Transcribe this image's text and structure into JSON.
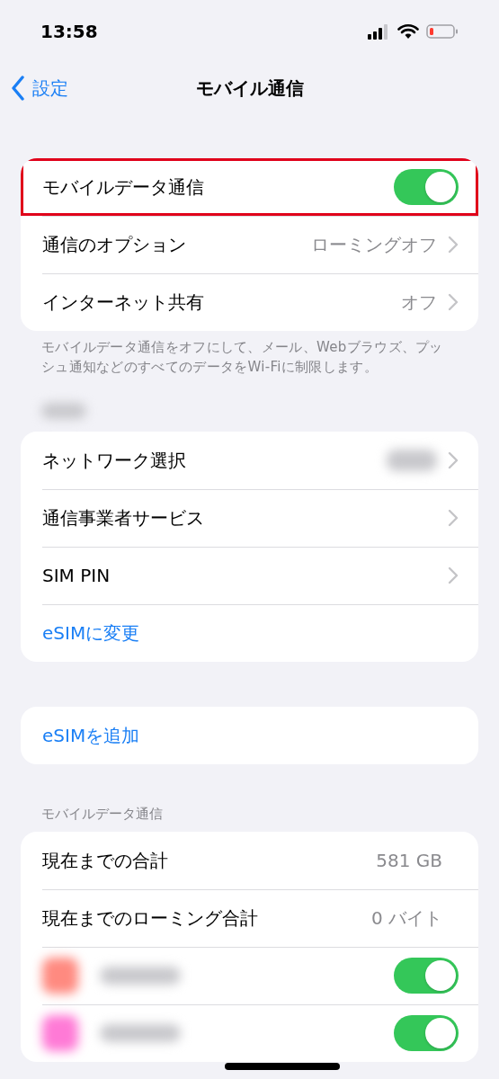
{
  "status_bar": {
    "time": "13:58"
  },
  "nav": {
    "back_label": "設定",
    "title": "モバイル通信"
  },
  "sections": [
    {
      "rows": [
        {
          "kind": "toggle",
          "label": "モバイルデータ通信",
          "on": true,
          "highlighted": true
        },
        {
          "kind": "detail",
          "label": "通信のオプション",
          "value": "ローミングオフ"
        },
        {
          "kind": "detail",
          "label": "インターネット共有",
          "value": "オフ"
        }
      ],
      "footer": "モバイルデータ通信をオフにして、メール、Webブラウズ、プッシュ通知などのすべてのデータをWi-Fiに制限します。"
    },
    {
      "redacted_header": true,
      "rows": [
        {
          "kind": "detail",
          "label": "ネットワーク選択",
          "redacted_value": true
        },
        {
          "kind": "detail",
          "label": "通信事業者サービス"
        },
        {
          "kind": "detail",
          "label": "SIM PIN"
        },
        {
          "kind": "link",
          "label": "eSIMに変更"
        }
      ]
    },
    {
      "rows": [
        {
          "kind": "link",
          "label": "eSIMを追加"
        }
      ]
    },
    {
      "header": "モバイルデータ通信",
      "rows": [
        {
          "kind": "stat",
          "label": "現在までの合計",
          "value": "581 GB"
        },
        {
          "kind": "stat",
          "label": "現在までのローミング合計",
          "value": "0 バイト"
        },
        {
          "kind": "app",
          "on": true,
          "color": "#ff8a80"
        },
        {
          "kind": "app",
          "on": true,
          "color": "#ff7ad6"
        }
      ]
    }
  ]
}
